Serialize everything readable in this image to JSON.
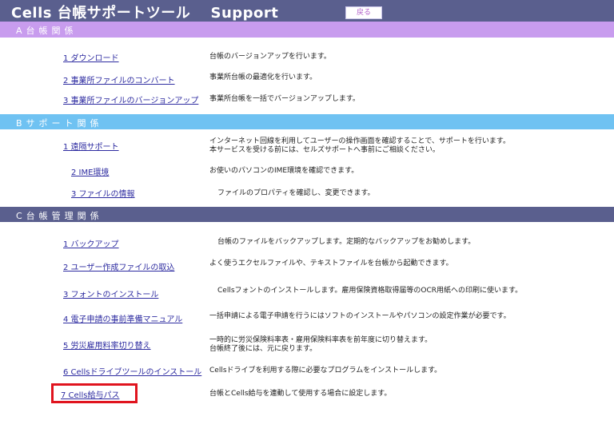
{
  "header": {
    "title": "Cells  台帳サポートツール　 Support",
    "back_label": "戻る"
  },
  "sections": [
    {
      "label": "A台帳関係",
      "items": [
        {
          "link": "1  ダウンロード",
          "desc": [
            "台帳のバージョンアップを行います。"
          ]
        },
        {
          "link": "2  事業所ファイルのコンバート",
          "desc": [
            "事業所台帳の最適化を行います。"
          ]
        },
        {
          "link": "3  事業所ファイルのバージョンアップ",
          "desc": [
            "事業所台帳を一括でバージョンアップします。"
          ]
        }
      ]
    },
    {
      "label": "Bサポート関係",
      "items": [
        {
          "link": "1  遠隔サポート",
          "desc": [
            "インターネット回線を利用してユーザーの操作画面を確認することで、サポートを行います。",
            "本サービスを受ける前には、セルズサポートへ事前にご相談ください。"
          ]
        },
        {
          "link": "2  IME環境",
          "desc": [
            "お使いのパソコンのIME環境を確認できます。"
          ]
        },
        {
          "link": "3  ファイルの情報",
          "desc": [
            "ファイルのプロパティを確認し、変更できます。"
          ]
        }
      ]
    },
    {
      "label": "C台帳管理関係",
      "items": [
        {
          "link": "1  バックアップ",
          "desc": [
            "台帳のファイルをバックアップします。定期的なバックアップをお勧めします。"
          ]
        },
        {
          "link": "2  ユーザー作成ファイルの取込",
          "desc": [
            "よく使うエクセルファイルや、テキストファイルを台帳から起動できます。"
          ]
        },
        {
          "link": "3  フォントのインストール",
          "desc": [
            "Cellsフォントのインストールします。雇用保険資格取得届等のOCR用紙への印刷に使います。"
          ]
        },
        {
          "link": "4  電子申請の事前準備マニュアル",
          "desc": [
            "一括申請による電子申請を行うにはソフトのインストールやパソコンの設定作業が必要です。"
          ]
        },
        {
          "link": "5  労災雇用料率切り替え",
          "desc": [
            "一時的に労災保険料率表・雇用保険料率表を前年度に切り替えます。",
            "台帳終了後には、元に戻ります。"
          ]
        },
        {
          "link": "6  Cellsドライブツールのインストール",
          "desc": [
            "Cellsドライブを利用する際に必要なプログラムをインストールします。"
          ]
        },
        {
          "link": "7 Cells給与パス",
          "desc": [
            "台帳とCells給与を連動して使用する場合に設定します。"
          ]
        }
      ]
    }
  ]
}
